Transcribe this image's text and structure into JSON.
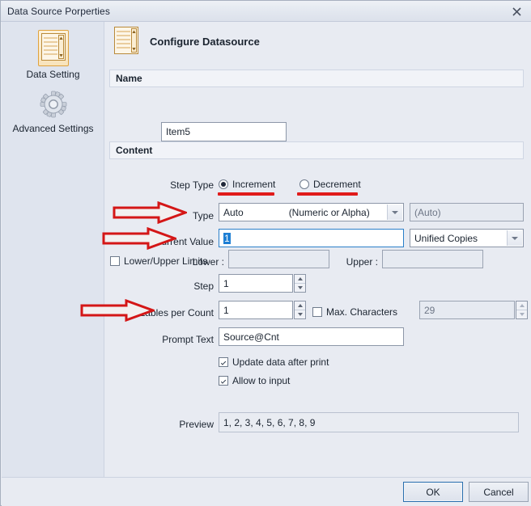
{
  "window": {
    "title": "Data Source Porperties",
    "close_icon": "close-icon"
  },
  "sidebar": {
    "items": [
      {
        "label": "Data Setting",
        "icon": "datasource-list-icon",
        "selected": true
      },
      {
        "label": "Advanced Settings",
        "icon": "gear-icon",
        "selected": false
      }
    ]
  },
  "header": {
    "icon": "datasource-list-icon",
    "title": "Configure Datasource"
  },
  "sections": {
    "name": {
      "title": "Name",
      "value": "Item5"
    },
    "content": {
      "title": "Content"
    }
  },
  "form": {
    "step_type": {
      "label": "Step Type",
      "options": [
        {
          "label": "Increment",
          "selected": true
        },
        {
          "label": "Decrement",
          "selected": false
        }
      ]
    },
    "type": {
      "label": "Type",
      "value": "Auto",
      "value_hint": "(Numeric or Alpha)",
      "secondary_placeholder": "(Auto)"
    },
    "current_value": {
      "label": "Current Value",
      "value": "1",
      "value_selected": true,
      "copies_mode": "Unified Copies"
    },
    "limits": {
      "label": "Lower/Upper Limits",
      "checked": false,
      "lower_label": "Lower :",
      "lower_value": "",
      "upper_label": "Upper :",
      "upper_value": ""
    },
    "step": {
      "label": "Step",
      "value": "1"
    },
    "labels_per_count": {
      "label": "Lables per Count",
      "value": "1"
    },
    "max_characters": {
      "label": "Max. Characters",
      "checked": false,
      "value": "29"
    },
    "prompt_text": {
      "label": "Prompt Text",
      "value": "Source@Cnt"
    },
    "update_after_print": {
      "label": "Update data after print",
      "checked": true
    },
    "allow_input": {
      "label": "Allow to input",
      "checked": true
    },
    "preview": {
      "label": "Preview",
      "value": "1, 2, 3, 4, 5, 6, 7, 8, 9"
    }
  },
  "footer": {
    "ok_label": "OK",
    "cancel_label": "Cancel"
  },
  "annotations": {
    "accent_color": "#e01b1b",
    "arrows": [
      "arrow-type",
      "arrow-current-value",
      "arrow-labels-per-count"
    ],
    "underlines": [
      "underline-increment",
      "underline-decrement"
    ]
  }
}
